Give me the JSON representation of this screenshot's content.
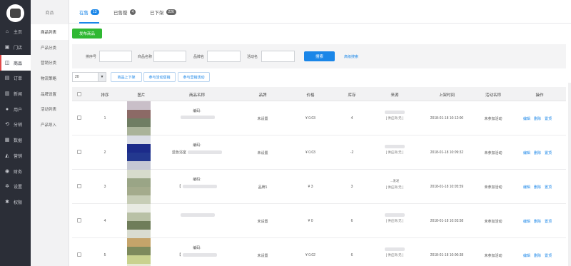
{
  "sidebar": {
    "items": [
      {
        "label": "主页",
        "icon": "home-icon",
        "glyph": "⌂"
      },
      {
        "label": "门店",
        "icon": "store-icon",
        "glyph": "▣"
      },
      {
        "label": "商品",
        "icon": "bag-icon",
        "glyph": "◫",
        "active": true
      },
      {
        "label": "订单",
        "icon": "order-icon",
        "glyph": "▤"
      },
      {
        "label": "新闻",
        "icon": "news-icon",
        "glyph": "▥"
      },
      {
        "label": "用户",
        "icon": "user-icon",
        "glyph": "●"
      },
      {
        "label": "分销",
        "icon": "share-icon",
        "glyph": "⟲"
      },
      {
        "label": "数据",
        "icon": "chart-icon",
        "glyph": "▦"
      },
      {
        "label": "营销",
        "icon": "megaphone-icon",
        "glyph": "◭"
      },
      {
        "label": "财务",
        "icon": "finance-icon",
        "glyph": "◉"
      },
      {
        "label": "设置",
        "icon": "gear-icon",
        "glyph": "✲"
      },
      {
        "label": "权限",
        "icon": "permission-icon",
        "glyph": "✱"
      }
    ]
  },
  "subbar": {
    "title": "商品",
    "items": [
      {
        "label": "商品列表",
        "active": true
      },
      {
        "label": "产品分类"
      },
      {
        "label": "营销分类"
      },
      {
        "label": "物流策略"
      },
      {
        "label": "品牌设置"
      },
      {
        "label": "活动列表"
      },
      {
        "label": "产品导入"
      }
    ]
  },
  "tabs": [
    {
      "label": "在售",
      "count": "13",
      "active": true
    },
    {
      "label": "已售罄",
      "count": "4"
    },
    {
      "label": "已下架",
      "count": "226"
    }
  ],
  "publish_label": "发布商品",
  "filter": {
    "fields": [
      {
        "label": "排序号",
        "value": ""
      },
      {
        "label": "商品名称",
        "value": ""
      },
      {
        "label": "品牌名",
        "value": ""
      },
      {
        "label": "活动名",
        "value": ""
      }
    ],
    "search_label": "搜索",
    "advanced_label": "高级搜索"
  },
  "toolbar": {
    "page_size": "20",
    "buttons": [
      "商品上下架",
      "参与活动促销",
      "参与营销活动"
    ]
  },
  "table": {
    "columns": [
      "排序",
      "图片",
      "商品名称",
      "品牌",
      "价格",
      "库存",
      "来源",
      "上架时间",
      "活动名称",
      "操作"
    ],
    "rows": [
      {
        "index": "1",
        "name_prefix": "编码:",
        "name_line2": "",
        "brand": "未设置",
        "price": "¥ 0.03",
        "stock": "4",
        "source": "[ 供应商:无 ]",
        "time": "2018-01-18 10:12:00",
        "activity": "未参加活动",
        "colors": [
          "#c9bfc8",
          "#8c6a66",
          "#6f7d63",
          "#aab39a"
        ]
      },
      {
        "index": "2",
        "name_prefix": "编码:",
        "name_line2": "蓝色浴室",
        "brand": "未设置",
        "price": "¥ 0.03",
        "stock": "-2",
        "source": "[ 供应商:无 ]",
        "time": "2018-01-18 10:09:32",
        "activity": "未参加活动",
        "colors": [
          "#dadde6",
          "#1c2b8a",
          "#23388f",
          "#c5c8d4"
        ]
      },
      {
        "index": "3",
        "name_prefix": "编码:",
        "name_line2": "【",
        "brand": "品牌1",
        "price": "¥ 3",
        "stock": "3",
        "source": "[ 供应商:无 ]",
        "source_top": "...发发",
        "time": "2018-01-18 10:05:59",
        "activity": "未参加活动",
        "colors": [
          "#d7dbcc",
          "#9aa586",
          "#a4ab8c",
          "#c7cdb6"
        ]
      },
      {
        "index": "4",
        "name_prefix": "",
        "name_line2": "",
        "brand": "未设置",
        "price": "¥ 0",
        "stock": "6",
        "source": "[ 供应商:无 ]",
        "time": "2018-01-18 10:03:58",
        "activity": "未参加活动",
        "colors": [
          "#e8eae2",
          "#b9c1a6",
          "#6f7d5a",
          "#d9dcd0"
        ]
      },
      {
        "index": "5",
        "name_prefix": "编码:",
        "name_line2": "【",
        "brand": "未设置",
        "price": "¥ 0.02",
        "stock": "6",
        "source": "[ 供应商:无 ]",
        "time": "2018-01-18 10:00:38",
        "activity": "未参加活动",
        "colors": [
          "#c5a46a",
          "#7d8a5c",
          "#c9d28f",
          "#e6e9d2"
        ]
      }
    ],
    "actions": [
      "编辑",
      "删除",
      "置顶"
    ]
  }
}
